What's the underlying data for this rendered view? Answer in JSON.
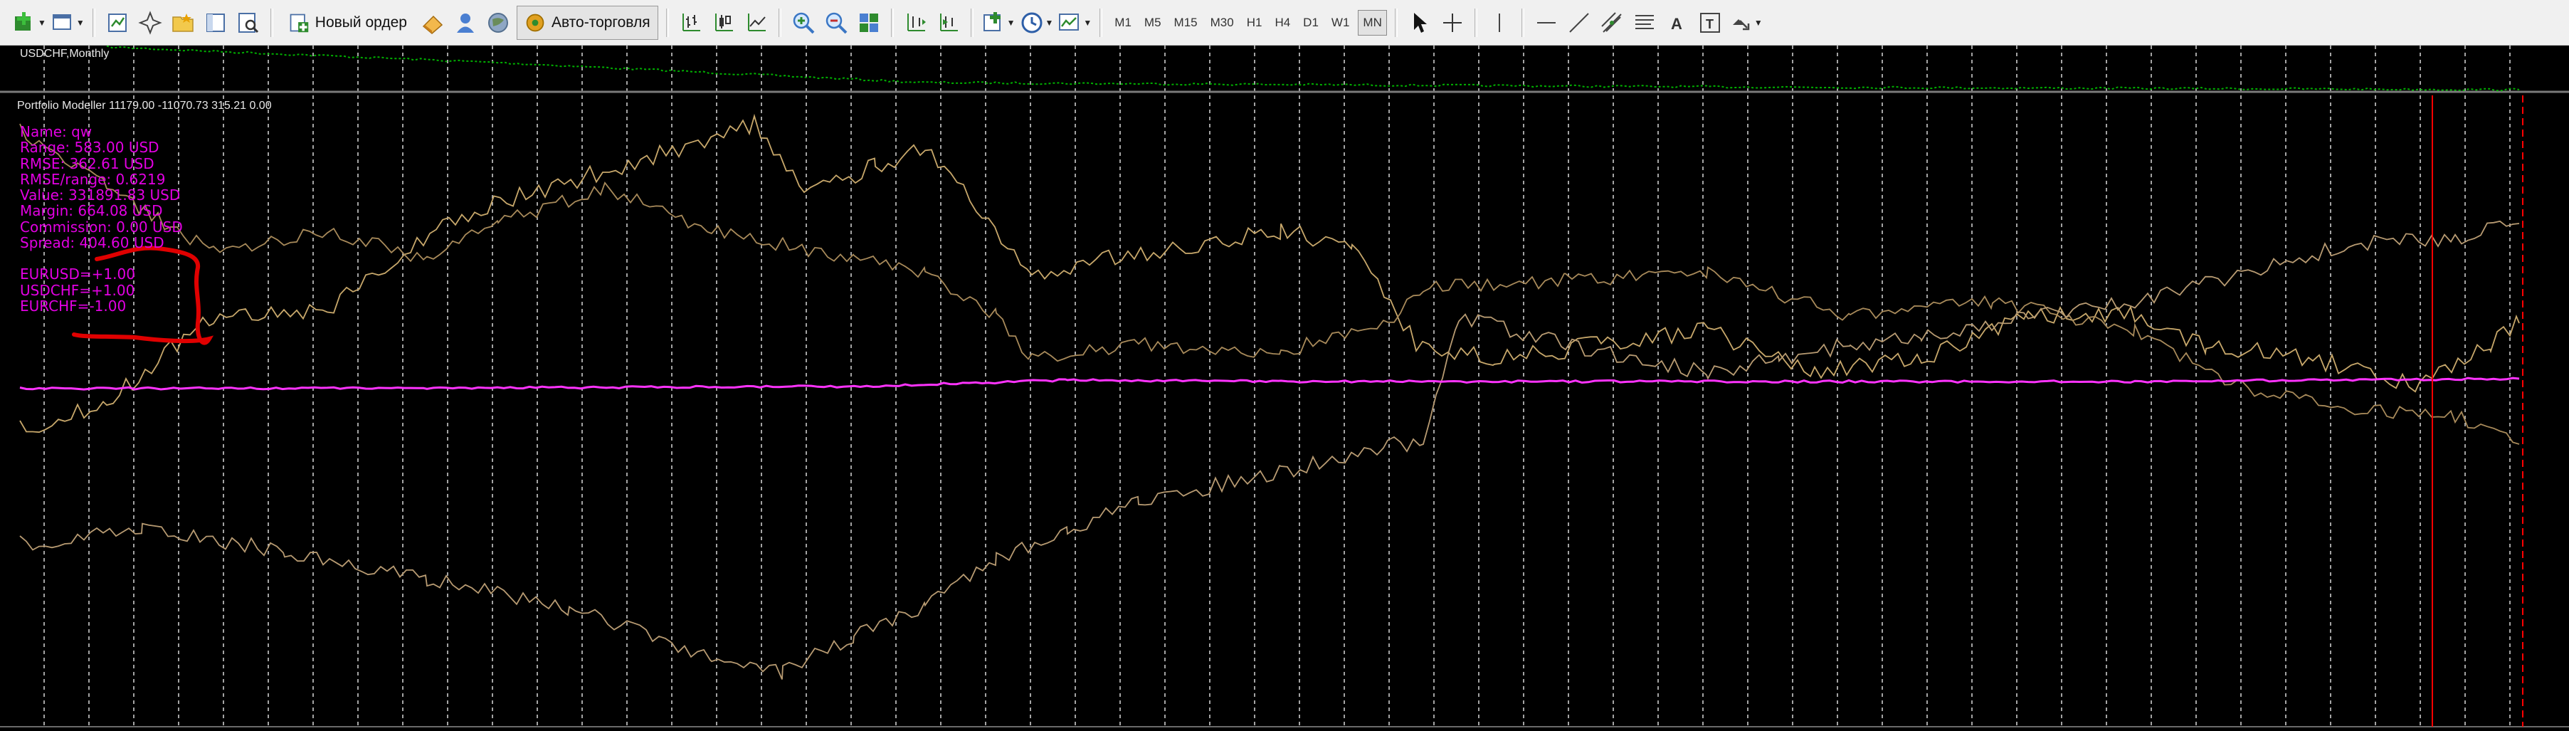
{
  "toolbar": {
    "new_order_label": "Новый ордер",
    "autotrading_label": "Авто-торговля",
    "timeframes": [
      "M1",
      "M5",
      "M15",
      "M30",
      "H1",
      "H4",
      "D1",
      "W1",
      "MN"
    ],
    "active_timeframe": "MN"
  },
  "chart": {
    "symbol_title": "USDCHF,Monthly",
    "indicator_title": "Portfolio Modeller 11179.00 -11070.73 315.21 0.00",
    "background": "#000000",
    "grid_color": "#ffffff",
    "price_line_color": "#00b000",
    "portfolio_line_color": "#ff33ff",
    "series_colors": [
      "#c8a86b",
      "#a88a5a",
      "#b89b72"
    ],
    "marker_color": "#ff0000",
    "annotation_color": "#e00000"
  },
  "stats": {
    "color": "#e200e2",
    "name": "Name: qw",
    "range": "Range: 583.00 USD",
    "rmse": "RMSE: 362.61 USD",
    "rmse_range": "RMSE/range: 0.6219",
    "value": "Value: 331891.83 USD",
    "margin": "Margin: 664.08 USD",
    "commission": "Commission: 0.00 USD",
    "spread": "Spread: 404.60 USD",
    "pair1": "EURUSD=+1.00",
    "pair2": "USDCHF=+1.00",
    "pair3": "EURCHF=-1.00"
  }
}
